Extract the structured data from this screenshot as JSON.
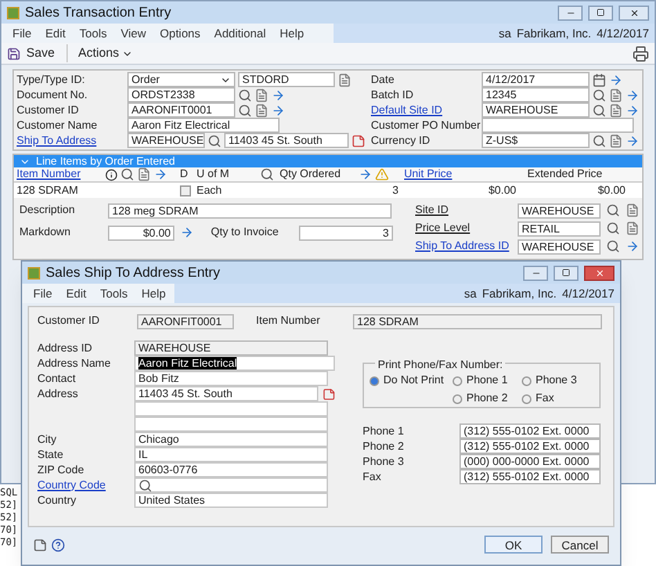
{
  "window": {
    "title": "Sales Transaction Entry",
    "menu": [
      "File",
      "Edit",
      "Tools",
      "View",
      "Options",
      "Additional",
      "Help"
    ],
    "user": "sa",
    "company": "Fabrikam, Inc.",
    "date": "4/12/2017"
  },
  "toolbar": {
    "save": "Save",
    "actions": "Actions"
  },
  "header_left": [
    {
      "label": "Type/Type ID:",
      "link": false,
      "value": "Order",
      "kind": "dropdown",
      "value2": "STDORD"
    },
    {
      "label": "Document No.",
      "link": false,
      "value": "ORDST2338",
      "kind": "lookup"
    },
    {
      "label": "Customer ID",
      "link": false,
      "value": "AARONFIT0001",
      "kind": "lookup"
    },
    {
      "label": "Customer Name",
      "link": false,
      "value": "Aaron Fitz Electrical",
      "kind": "plain"
    },
    {
      "label": "Ship To Address",
      "link": true,
      "value": "WAREHOUSE",
      "kind": "address",
      "value2": "11403 45 St. South"
    }
  ],
  "header_right": [
    {
      "label": "Date",
      "link": false,
      "value": "4/12/2017",
      "kind": "date"
    },
    {
      "label": "Batch ID",
      "link": false,
      "value": "12345",
      "kind": "lookup"
    },
    {
      "label": "Default Site ID",
      "link": true,
      "value": "WAREHOUSE",
      "kind": "lookup"
    },
    {
      "label": "Customer PO Number",
      "link": false,
      "kind": "plain"
    },
    {
      "label": "Currency ID",
      "link": false,
      "value": "Z-US$",
      "kind": "lookup"
    }
  ],
  "line_items": {
    "title": "Line Items by Order Entered",
    "columns": [
      {
        "label": "Item Number",
        "link": true
      },
      {
        "label": "D",
        "link": false
      },
      {
        "label": "U of M",
        "link": false
      },
      {
        "label": "Qty Ordered",
        "link": false
      },
      {
        "label": "Unit Price",
        "link": true
      },
      {
        "label": "Extended Price",
        "link": false
      }
    ],
    "row": {
      "item": "128 SDRAM",
      "checked": false,
      "uom": "Each",
      "qty": "3",
      "unit_price": "$0.00",
      "extended": "$0.00"
    }
  },
  "details": {
    "description_label": "Description",
    "description": "128 meg SDRAM",
    "markdown_label": "Markdown",
    "markdown": "$0.00",
    "qty_label": "Qty to Invoice",
    "qty": "3",
    "right": [
      {
        "label": "Site ID",
        "link": false,
        "value": "WAREHOUSE"
      },
      {
        "label": "Price Level",
        "link": false,
        "value": "RETAIL"
      },
      {
        "label": "Ship To Address ID",
        "link": true,
        "value": "WAREHOUSE"
      }
    ]
  },
  "log_lines": [
    "SQL",
    "52]",
    "52]",
    "70]",
    "70]"
  ],
  "dialog": {
    "title": "Sales Ship To Address Entry",
    "menu": [
      "File",
      "Edit",
      "Tools",
      "Help"
    ],
    "user": "sa",
    "company": "Fabrikam, Inc.",
    "date": "4/12/2017",
    "customer_id_label": "Customer ID",
    "customer_id": "AARONFIT0001",
    "item_number_label": "Item Number",
    "item_number": "128 SDRAM",
    "address_id_label": "Address ID",
    "address_id": "WAREHOUSE",
    "fields": [
      {
        "label": "Address Name",
        "value": "Aaron Fitz Electrical",
        "highlighted": true,
        "link": false
      },
      {
        "label": "Contact",
        "value": "Bob Fitz",
        "highlighted": false,
        "link": false
      },
      {
        "label": "Address",
        "value": "11403 45 St. South",
        "highlighted": false,
        "link": false,
        "kind": "address"
      },
      {
        "kind": "blank"
      },
      {
        "kind": "blank"
      },
      {
        "label": "City",
        "value": "Chicago",
        "highlighted": false,
        "link": false
      },
      {
        "label": "State",
        "value": "IL",
        "highlighted": false,
        "link": false
      },
      {
        "label": "ZIP Code",
        "value": "60603-0776",
        "highlighted": false,
        "link": false
      },
      {
        "label": "Country Code",
        "link": true,
        "kind": "lookup"
      },
      {
        "label": "Country",
        "value": "United States",
        "highlighted": false,
        "link": false
      }
    ],
    "print_title": "Print Phone/Fax Number:",
    "print_options": [
      {
        "label": "Do Not Print",
        "selected": true
      },
      {
        "label": "Phone 1",
        "selected": false
      },
      {
        "label": "Phone 3",
        "selected": false
      },
      {
        "label": "Phone 2",
        "selected": false
      },
      {
        "label": "Fax",
        "selected": false
      }
    ],
    "phones": [
      {
        "label": "Phone 1",
        "value": "(312) 555-0102  Ext. 0000"
      },
      {
        "label": "Phone 2",
        "value": "(312) 555-0102  Ext. 0000"
      },
      {
        "label": "Phone 3",
        "value": "(000) 000-0000  Ext. 0000"
      },
      {
        "label": "Fax",
        "value": "(312) 555-0102  Ext. 0000"
      }
    ],
    "buttons": [
      "OK",
      "Cancel"
    ]
  }
}
